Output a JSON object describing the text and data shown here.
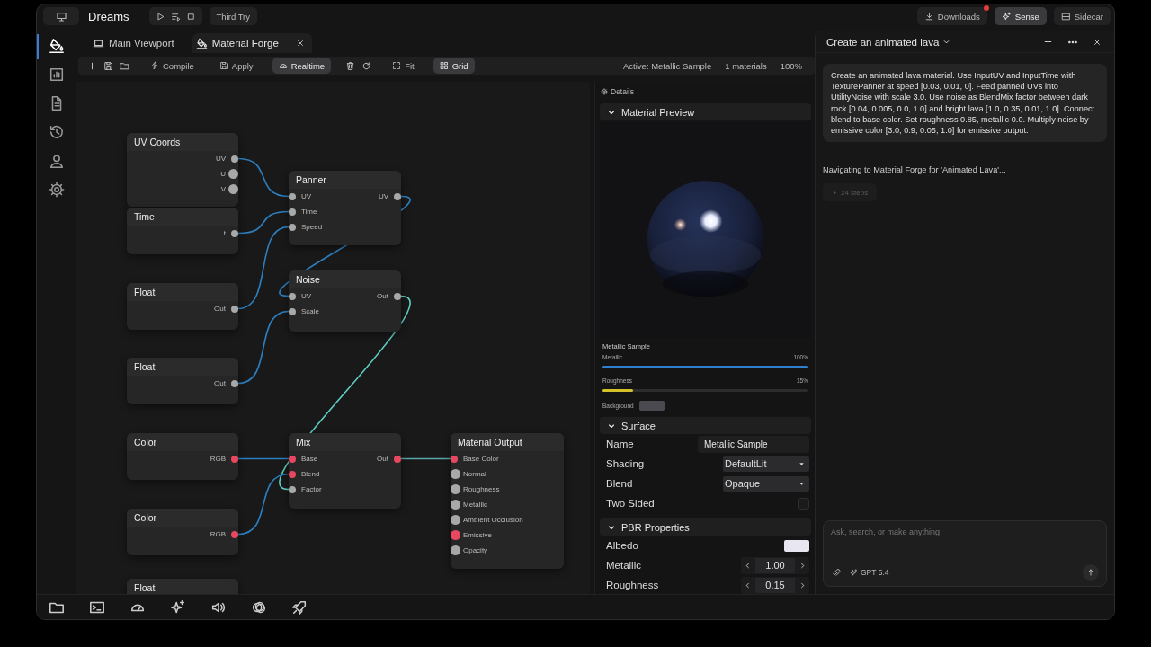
{
  "topbar": {
    "title": "Dreams",
    "project": "Third Try",
    "actions": [
      {
        "label": "Downloads",
        "badge": true,
        "selected": false
      },
      {
        "label": "Sense",
        "badge": false,
        "selected": true
      },
      {
        "label": "Sidecar",
        "badge": false,
        "selected": false
      }
    ]
  },
  "rail": [
    {
      "selected": true
    },
    {
      "selected": false
    },
    {
      "selected": false
    },
    {
      "selected": false
    },
    {
      "selected": false
    },
    {
      "selected": false
    }
  ],
  "tabs": [
    {
      "label": "Main Viewport",
      "selected": false,
      "closable": false
    },
    {
      "label": "Material Forge",
      "selected": true,
      "closable": true
    }
  ],
  "toolbar": {
    "buttons": [
      {
        "label": "Compile",
        "on": false
      },
      {
        "label": "Apply",
        "on": false
      },
      {
        "label": "Realtime",
        "on": true
      },
      {
        "label": "Fit",
        "on": false
      },
      {
        "label": "Grid",
        "on": true
      }
    ],
    "status": [
      "Active: Metallic Sample",
      "1 materials",
      "100%"
    ]
  },
  "graph": {
    "nodes": [
      {
        "title": "UV Coords",
        "outputs": [
          {
            "label": "UV",
            "kind": "value",
            "connected": true
          },
          {
            "label": "U",
            "kind": "value",
            "connected": false
          },
          {
            "label": "V",
            "kind": "value",
            "connected": false
          }
        ]
      },
      {
        "title": "Time",
        "outputs": [
          {
            "label": "t",
            "kind": "value",
            "connected": true
          }
        ]
      },
      {
        "title": "Float",
        "outputs": [
          {
            "label": "Out",
            "kind": "value",
            "connected": true
          }
        ]
      },
      {
        "title": "Float",
        "outputs": [
          {
            "label": "Out",
            "kind": "value",
            "connected": true
          }
        ]
      },
      {
        "title": "Color",
        "outputs": [
          {
            "label": "RGB",
            "kind": "color",
            "connected": true
          }
        ]
      },
      {
        "title": "Color",
        "outputs": [
          {
            "label": "RGB",
            "kind": "color",
            "connected": true
          }
        ]
      },
      {
        "title": "Float"
      },
      {
        "title": "Panner",
        "inputs": [
          {
            "label": "UV",
            "kind": "value",
            "connected": true
          },
          {
            "label": "Time",
            "kind": "value",
            "connected": true
          },
          {
            "label": "Speed",
            "kind": "value",
            "connected": true
          }
        ],
        "outputs": [
          {
            "label": "UV",
            "kind": "value",
            "connected": true
          }
        ]
      },
      {
        "title": "Noise",
        "inputs": [
          {
            "label": "UV",
            "kind": "value",
            "connected": true
          },
          {
            "label": "Scale",
            "kind": "value",
            "connected": true
          }
        ],
        "outputs": [
          {
            "label": "Out",
            "kind": "value",
            "connected": true
          }
        ]
      },
      {
        "title": "Mix",
        "inputs": [
          {
            "label": "Base",
            "kind": "color",
            "connected": true
          },
          {
            "label": "Blend",
            "kind": "color",
            "connected": true
          },
          {
            "label": "Factor",
            "kind": "value",
            "connected": true
          }
        ],
        "outputs": [
          {
            "label": "Out",
            "kind": "color",
            "connected": true
          }
        ]
      },
      {
        "title": "Material Output",
        "inputs": [
          {
            "label": "Base Color",
            "kind": "color",
            "connected": true
          },
          {
            "label": "Normal",
            "kind": "value",
            "connected": false
          },
          {
            "label": "Roughness",
            "kind": "value",
            "connected": false
          },
          {
            "label": "Metallic",
            "kind": "value",
            "connected": false
          },
          {
            "label": "Ambient Occlusion",
            "kind": "value",
            "connected": false
          },
          {
            "label": "Emissive",
            "kind": "color",
            "connected": false
          },
          {
            "label": "Opacity",
            "kind": "value",
            "connected": false
          }
        ]
      }
    ]
  },
  "details": {
    "title": "Details",
    "preview": {
      "title": "Material Preview",
      "expanded": true,
      "caption": "Metallic Sample",
      "sliders": [
        {
          "label": "Metallic",
          "reading": "100%",
          "level": 1.0,
          "color": "#2f7fd0"
        },
        {
          "label": "Roughness",
          "reading": "15%",
          "level": 0.15,
          "color": "#d4c12a"
        }
      ],
      "background": {
        "label": "Background",
        "color": "#4a4a50"
      }
    },
    "sections": [
      {
        "title": "Surface",
        "expanded": true,
        "rows": [
          {
            "kind": "text",
            "label": "Name",
            "value": "Metallic Sample"
          },
          {
            "kind": "select",
            "label": "Shading",
            "value": "DefaultLit"
          },
          {
            "kind": "select",
            "label": "Blend",
            "value": "Opaque"
          },
          {
            "kind": "checkbox",
            "label": "Two Sided",
            "checked": false
          }
        ]
      },
      {
        "title": "PBR Properties",
        "expanded": true,
        "rows": [
          {
            "kind": "swatch",
            "label": "Albedo",
            "color": "#e8e6f0"
          },
          {
            "kind": "stepper",
            "label": "Metallic",
            "value": "1.00"
          },
          {
            "kind": "stepper",
            "label": "Roughness",
            "value": "0.15"
          }
        ]
      }
    ]
  },
  "chat": {
    "title": "Create an animated lava",
    "messages": [
      {
        "kind": "user",
        "text": "Create an animated lava material. Use InputUV and InputTime with TexturePanner at speed [0.03, 0.01, 0]. Feed panned UVs into UtilityNoise with scale 3.0. Use noise as BlendMix factor between dark rock [0.04, 0.005, 0.0, 1.0] and bright lava [1.0, 0.35, 0.01, 1.0]. Connect blend to base color. Set roughness 0.85, metallic 0.0. Multiply noise by emissive color [3.0, 0.9, 0.05, 1.0] for emissive output."
      },
      {
        "kind": "status",
        "text": "Navigating to Material Forge for 'Animated Lava'..."
      }
    ],
    "steps": {
      "label": "24 steps",
      "expanded": false
    },
    "input": {
      "placeholder": "Ask, search, or make anything",
      "model": "GPT 5.4"
    }
  }
}
